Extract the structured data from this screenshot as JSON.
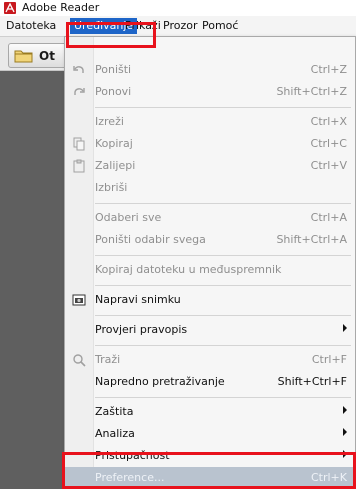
{
  "window": {
    "title": "Adobe Reader"
  },
  "menubar": {
    "items": [
      {
        "label": "Datoteka"
      },
      {
        "label": "Uređivanje"
      },
      {
        "label": "Prikaži"
      },
      {
        "label": "Prozor"
      },
      {
        "label": "Pomoć"
      }
    ]
  },
  "toolbar": {
    "open_label": "Ot"
  },
  "edit_menu": {
    "items": [
      {
        "label": "Poništi",
        "shortcut": "Ctrl+Z",
        "state": "disabled"
      },
      {
        "label": "Ponovi",
        "shortcut": "Shift+Ctrl+Z",
        "state": "disabled"
      },
      {
        "label": "Izreži",
        "shortcut": "Ctrl+X",
        "state": "disabled"
      },
      {
        "label": "Kopiraj",
        "shortcut": "Ctrl+C",
        "state": "disabled"
      },
      {
        "label": "Zalijepi",
        "shortcut": "Ctrl+V",
        "state": "disabled"
      },
      {
        "label": "Izbriši",
        "shortcut": "",
        "state": "disabled"
      },
      {
        "label": "Odaberi sve",
        "shortcut": "Ctrl+A",
        "state": "disabled"
      },
      {
        "label": "Poništi odabir svega",
        "shortcut": "Shift+Ctrl+A",
        "state": "disabled"
      },
      {
        "label": "Kopiraj datoteku u međuspremnik",
        "shortcut": "",
        "state": "disabled"
      },
      {
        "label": "Napravi snimku",
        "shortcut": "",
        "state": "enabled"
      },
      {
        "label": "Provjeri pravopis",
        "shortcut": "",
        "state": "enabled",
        "submenu": true
      },
      {
        "label": "Traži",
        "shortcut": "Ctrl+F",
        "state": "disabled"
      },
      {
        "label": "Napredno pretraživanje",
        "shortcut": "Shift+Ctrl+F",
        "state": "enabled"
      },
      {
        "label": "Zaštita",
        "shortcut": "",
        "state": "enabled",
        "submenu": true
      },
      {
        "label": "Analiza",
        "shortcut": "",
        "state": "enabled",
        "submenu": true
      },
      {
        "label": "Pristupačnost",
        "shortcut": "",
        "state": "enabled",
        "submenu": true
      },
      {
        "label": "Preference...",
        "shortcut": "Ctrl+K",
        "state": "highlighted"
      }
    ]
  },
  "colors": {
    "menu_highlight": "#1e65c8",
    "annotation_red": "#e8121c"
  }
}
